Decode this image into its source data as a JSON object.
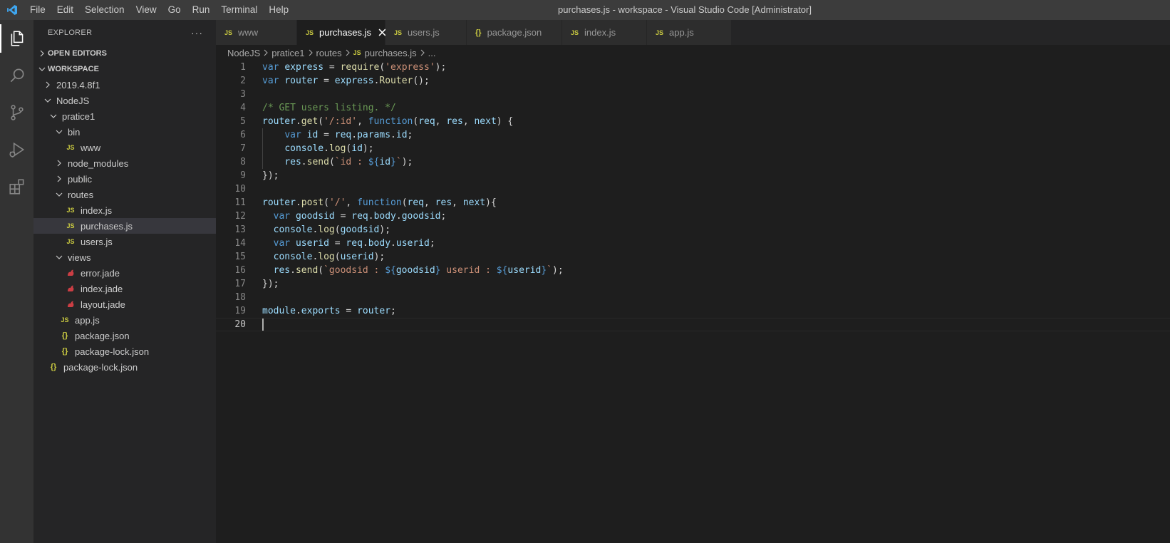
{
  "titlebar": {
    "menu": [
      "File",
      "Edit",
      "Selection",
      "View",
      "Go",
      "Run",
      "Terminal",
      "Help"
    ],
    "window_title": "purchases.js - workspace - Visual Studio Code [Administrator]"
  },
  "activity_bar": [
    "explorer-icon",
    "search-icon",
    "source-control-icon",
    "run-debug-icon",
    "extensions-icon"
  ],
  "sidebar": {
    "title": "EXPLORER",
    "more": "···",
    "open_editors": "OPEN EDITORS",
    "workspace": "WORKSPACE",
    "tree": [
      {
        "label": "2019.4.8f1",
        "type": "folder-closed"
      },
      {
        "label": "NodeJS",
        "type": "folder-open"
      },
      {
        "label": "pratice1",
        "type": "folder-open"
      },
      {
        "label": "bin",
        "type": "folder-open"
      },
      {
        "label": "www",
        "type": "js"
      },
      {
        "label": "node_modules",
        "type": "folder-closed"
      },
      {
        "label": "public",
        "type": "folder-closed"
      },
      {
        "label": "routes",
        "type": "folder-open"
      },
      {
        "label": "index.js",
        "type": "js"
      },
      {
        "label": "purchases.js",
        "type": "js"
      },
      {
        "label": "users.js",
        "type": "js"
      },
      {
        "label": "views",
        "type": "folder-open"
      },
      {
        "label": "error.jade",
        "type": "jade"
      },
      {
        "label": "index.jade",
        "type": "jade"
      },
      {
        "label": "layout.jade",
        "type": "jade"
      },
      {
        "label": "app.js",
        "type": "js"
      },
      {
        "label": "package.json",
        "type": "json"
      },
      {
        "label": "package-lock.json",
        "type": "json"
      },
      {
        "label": "package-lock.json",
        "type": "json"
      }
    ]
  },
  "tabs": [
    {
      "label": "www",
      "type": "js"
    },
    {
      "label": "purchases.js",
      "type": "js",
      "active": true
    },
    {
      "label": "users.js",
      "type": "js"
    },
    {
      "label": "package.json",
      "type": "json"
    },
    {
      "label": "index.js",
      "type": "js"
    },
    {
      "label": "app.js",
      "type": "js"
    }
  ],
  "breadcrumb": [
    "NodeJS",
    "pratice1",
    "routes",
    "purchases.js",
    "..."
  ],
  "icon_text": {
    "js": "JS",
    "json": "{}"
  },
  "editor": {
    "line_numbers": [
      "1",
      "2",
      "3",
      "4",
      "5",
      "6",
      "7",
      "8",
      "9",
      "10",
      "11",
      "12",
      "13",
      "14",
      "15",
      "16",
      "17",
      "18",
      "19",
      "20"
    ],
    "lines": [
      "var express = require('express');",
      "var router = express.Router();",
      "",
      "/* GET users listing. */",
      "router.get('/:id', function(req, res, next) {",
      "    var id = req.params.id;",
      "    console.log(id);",
      "    res.send(`id : ${id}`);",
      "});",
      "",
      "router.post('/', function(req, res, next){",
      "  var goodsid = req.body.goodsid;",
      "  console.log(goodsid);",
      "  var userid = req.body.userid;",
      "  console.log(userid);",
      "  res.send(`goodsid : ${goodsid} userid : ${userid}`);",
      "});",
      "",
      "module.exports = router;",
      ""
    ]
  },
  "colors": {
    "accent_js": "#cbcb41",
    "jade": "#cc3e44",
    "keyword": "#569cd6",
    "string": "#ce9178",
    "comment": "#6a9955"
  }
}
